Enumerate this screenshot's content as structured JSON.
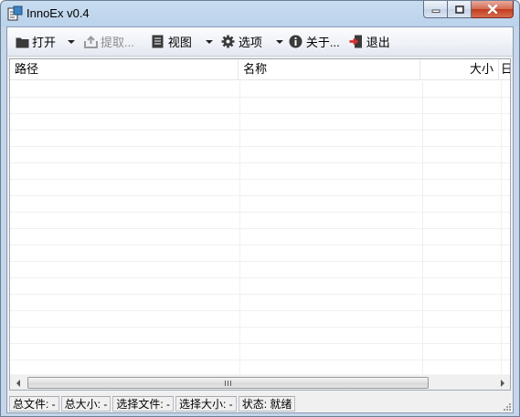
{
  "window": {
    "title": "InnoEx v0.4"
  },
  "toolbar": {
    "items": [
      {
        "label": "打开",
        "icon": "folder-icon",
        "has_dropdown": true,
        "enabled": true
      },
      {
        "label": "提取...",
        "icon": "export-icon",
        "has_dropdown": false,
        "enabled": false
      },
      {
        "label": "视图",
        "icon": "document-icon",
        "has_dropdown": true,
        "enabled": true
      },
      {
        "label": "选项",
        "icon": "gear-icon",
        "has_dropdown": true,
        "enabled": true
      },
      {
        "label": "关于...",
        "icon": "info-icon",
        "has_dropdown": false,
        "enabled": true
      },
      {
        "label": "退出",
        "icon": "exit-door-icon",
        "has_dropdown": false,
        "enabled": true
      }
    ]
  },
  "listview": {
    "columns": [
      "路径",
      "名称",
      "大小",
      "日"
    ],
    "rows": []
  },
  "hscroll": {
    "grip": "III"
  },
  "statusbar": {
    "panels": [
      "总文件: -",
      "总大小: -",
      "选择文件: -",
      "选择大小: -",
      "状态: 就绪"
    ]
  },
  "colors": {
    "frame": "#bad3ec",
    "close_button": "#c23b1e",
    "exit_icon": "#c62828"
  }
}
